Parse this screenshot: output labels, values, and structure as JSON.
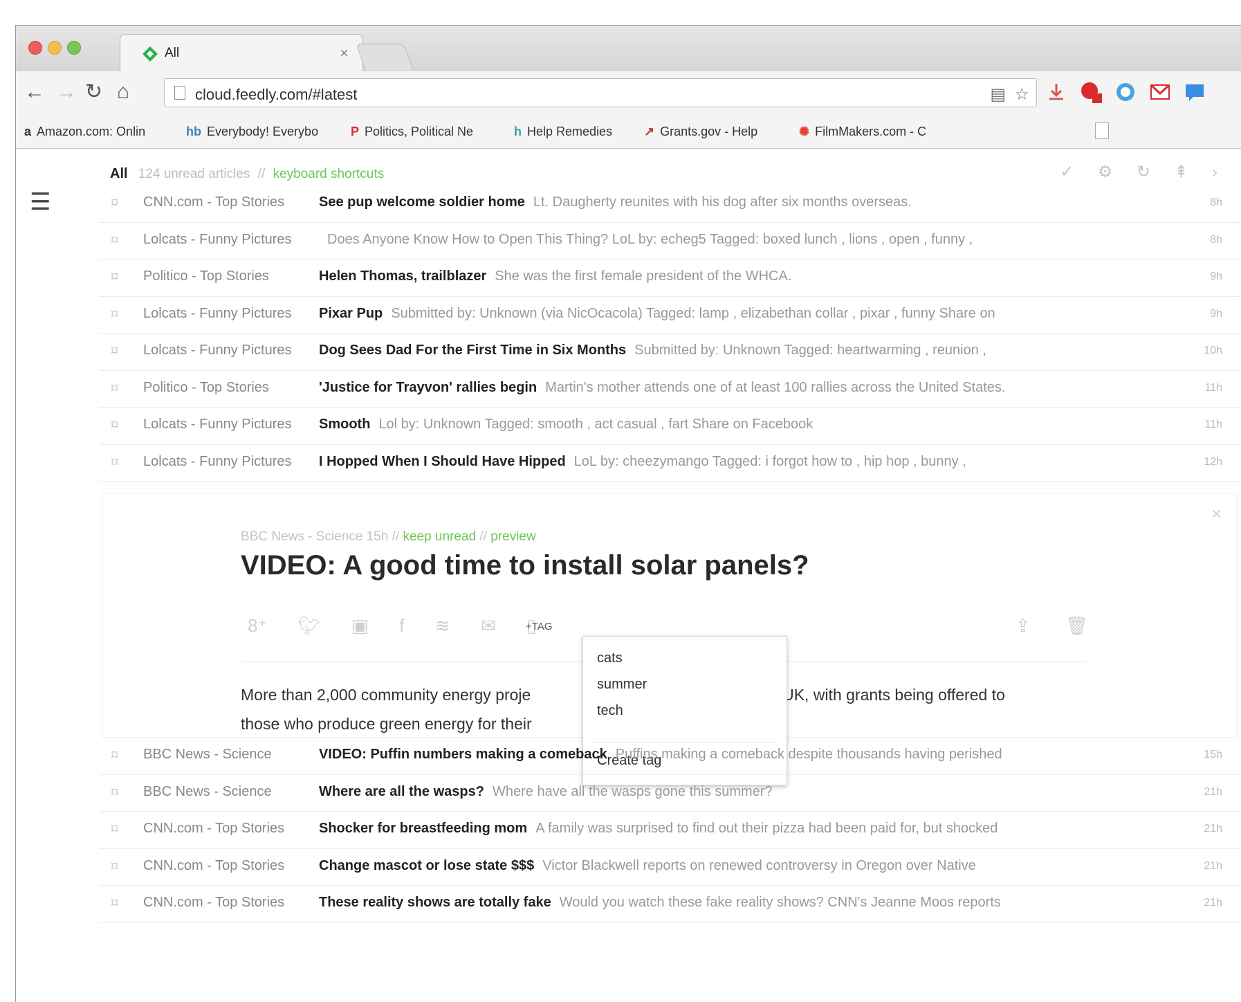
{
  "browser": {
    "tab_title": "All",
    "tab_close": "×",
    "url": "cloud.feedly.com/#latest",
    "bookmarks": [
      {
        "label": "Amazon.com: Onlin",
        "icon": "a"
      },
      {
        "label": "Everybody! Everybo",
        "icon": "hb"
      },
      {
        "label": "Politics, Political Ne",
        "icon": "P"
      },
      {
        "label": "Help Remedies",
        "icon": "h"
      },
      {
        "label": "Grants.gov - Help",
        "icon": "↗"
      },
      {
        "label": "FilmMakers.com - C",
        "icon": "✺"
      }
    ]
  },
  "header": {
    "title": "All",
    "unread": "124 unread articles",
    "separator": "//",
    "shortcuts": "keyboard shortcuts"
  },
  "articles_top": [
    {
      "source": "CNN.com - Top Stories",
      "title": "See pup welcome soldier home",
      "snippet": "Lt. Daugherty reunites with his dog after six months overseas.",
      "age": "8h"
    },
    {
      "source": "Lolcats - Funny Pictures",
      "title": "",
      "snippet": "Does Anyone Know How to Open This Thing?  LoL by: echeg5 Tagged: boxed lunch , lions , open , funny ,",
      "age": "8h"
    },
    {
      "source": "Politico - Top Stories",
      "title": "Helen Thomas, trailblazer",
      "snippet": "She was the first female president of the WHCA.",
      "age": "9h"
    },
    {
      "source": "Lolcats - Funny Pictures",
      "title": "Pixar Pup",
      "snippet": "Submitted by: Unknown (via NicOcacola) Tagged: lamp , elizabethan collar , pixar , funny Share on",
      "age": "9h"
    },
    {
      "source": "Lolcats - Funny Pictures",
      "title": "Dog Sees Dad For the First Time in Six Months",
      "snippet": "Submitted by: Unknown Tagged: heartwarming , reunion ,",
      "age": "10h"
    },
    {
      "source": "Politico - Top Stories",
      "title": "'Justice for Trayvon' rallies begin",
      "snippet": "Martin's mother attends one of at least 100 rallies across the United States.",
      "age": "11h"
    },
    {
      "source": "Lolcats - Funny Pictures",
      "title": "Smooth",
      "snippet": "Lol by: Unknown Tagged: smooth , act casual , fart Share on Facebook",
      "age": "11h"
    },
    {
      "source": "Lolcats - Funny Pictures",
      "title": "I Hopped When I Should Have Hipped",
      "snippet": "LoL by: cheezymango Tagged: i forgot how to , hip hop , bunny ,",
      "age": "12h"
    }
  ],
  "expanded": {
    "meta_source": "BBC News - Science 15h",
    "sep": "//",
    "keep_unread": "keep unread",
    "preview": "preview",
    "title": "VIDEO: A good time to install solar panels?",
    "tag_button": "+TAG",
    "text": "More than 2,000 community energy projects are operating across the UK, with grants being offered to those who produce green energy for their communities.",
    "text_line1_a": "More than 2,000 community energy proje",
    "text_line1_b": "ss the UK, with grants being offered to",
    "text_line2": "those who produce green energy for their",
    "close": "×",
    "tag_menu": [
      "cats",
      "summer",
      "tech"
    ],
    "create_tag": "Create tag"
  },
  "articles_bottom": [
    {
      "source": "BBC News - Science",
      "title": "VIDEO: Puffin numbers making a comeback",
      "snippet": "Puffins making a comeback despite thousands having perished",
      "age": "15h"
    },
    {
      "source": "BBC News - Science",
      "title": "Where are all the wasps?",
      "snippet": "Where have all the wasps gone this summer?",
      "age": "21h"
    },
    {
      "source": "CNN.com - Top Stories",
      "title": "Shocker for breastfeeding mom",
      "snippet": "A family was surprised to find out their pizza had been paid for, but shocked",
      "age": "21h"
    },
    {
      "source": "CNN.com - Top Stories",
      "title": "Change mascot or lose state $$$",
      "snippet": "Victor Blackwell reports on renewed controversy in Oregon over Native",
      "age": "21h"
    },
    {
      "source": "CNN.com - Top Stories",
      "title": "These reality shows are totally fake",
      "snippet": "Would you watch these fake reality shows? CNN's Jeanne Moos reports",
      "age": "21h"
    }
  ],
  "colors": {
    "accent_green": "#6cc655",
    "feedly_favicon": "#2bb24c"
  }
}
